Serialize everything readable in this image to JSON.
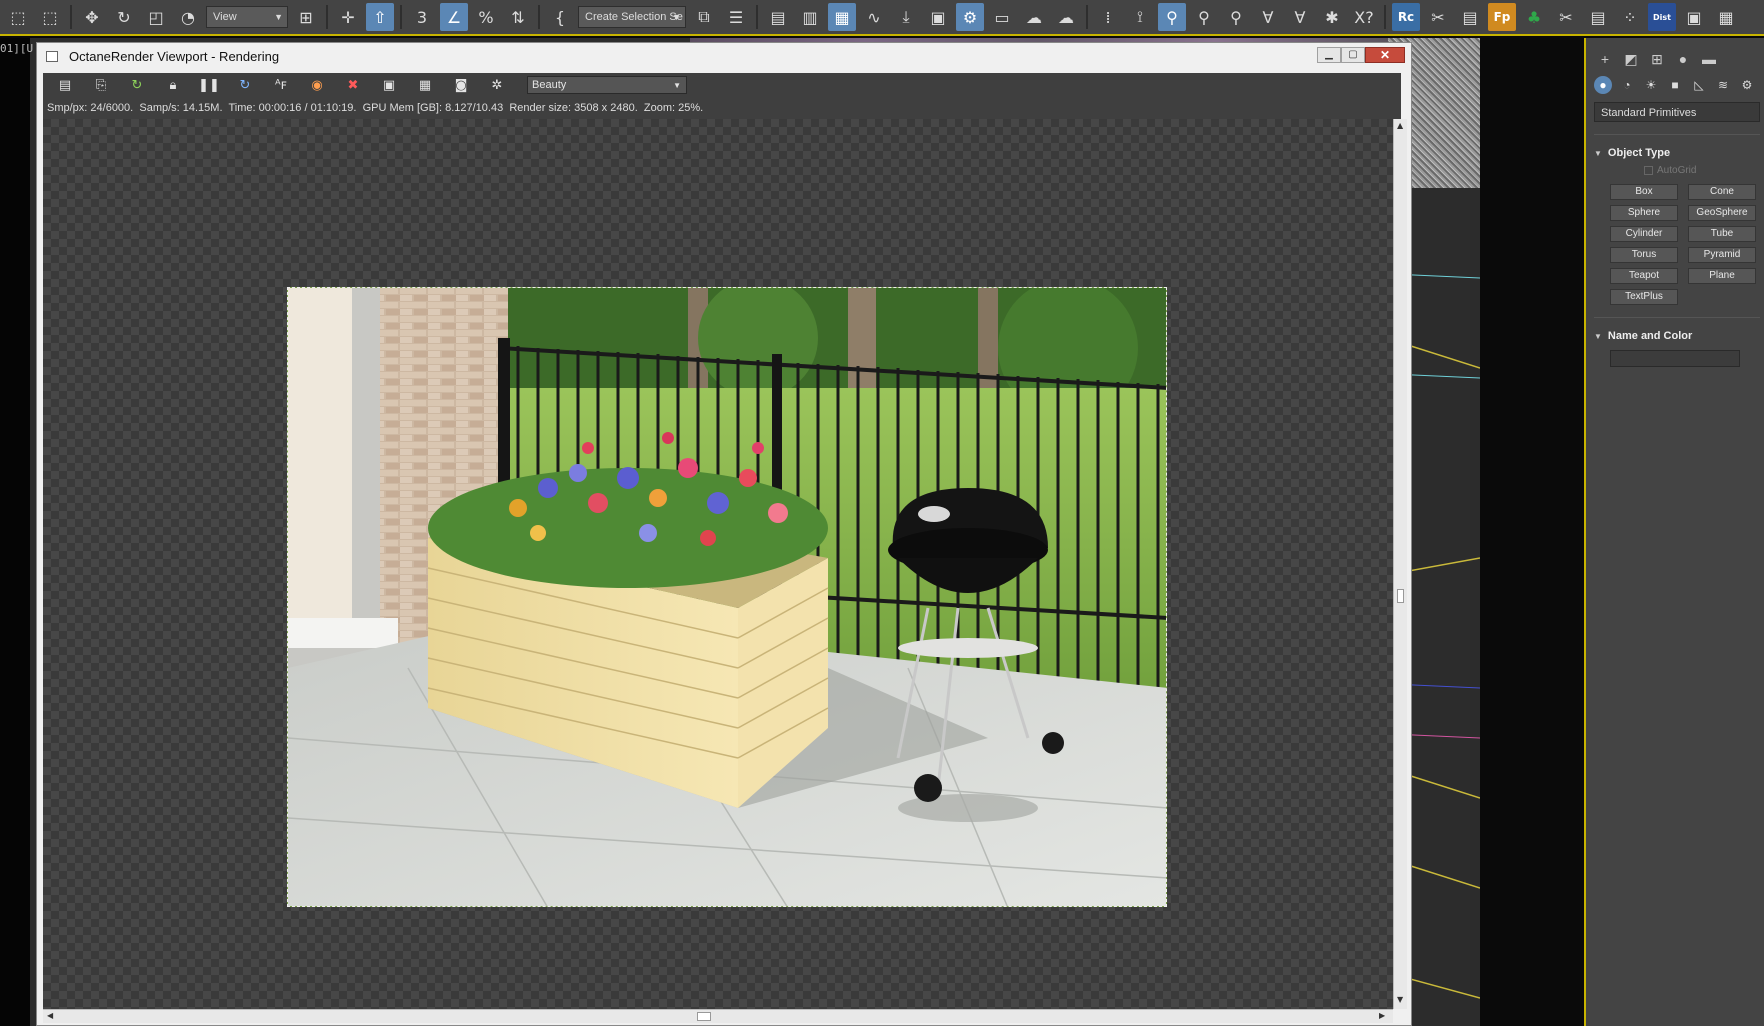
{
  "main_toolbar": {
    "reference_coord": "View",
    "selection_set": "Create Selection Se",
    "rc_label": "Rc",
    "fp_label": "Fp",
    "dist_label": "Dist"
  },
  "left_strip": {
    "label": "01][U"
  },
  "octane_window": {
    "title": "OctaneRender Viewport - Rendering",
    "render_pass": "Beauty",
    "status": {
      "smp_px": "Smp/px: 24/6000.",
      "samp_s": "Samp/s: 14.15M.",
      "time": "Time: 00:00:16 / 01:10:19.",
      "gpu_mem": "GPU Mem [GB]: 8.127/10.43",
      "render_size": "Render size: 3508 x 2480.",
      "zoom": "Zoom: 25%."
    }
  },
  "command_panel": {
    "category": "Standard Primitives",
    "object_type_title": "Object Type",
    "autogrid": "AutoGrid",
    "objects": [
      "Box",
      "Cone",
      "Sphere",
      "GeoSphere",
      "Cylinder",
      "Tube",
      "Torus",
      "Pyramid",
      "Teapot",
      "Plane",
      "TextPlus"
    ],
    "name_color_title": "Name and Color"
  }
}
